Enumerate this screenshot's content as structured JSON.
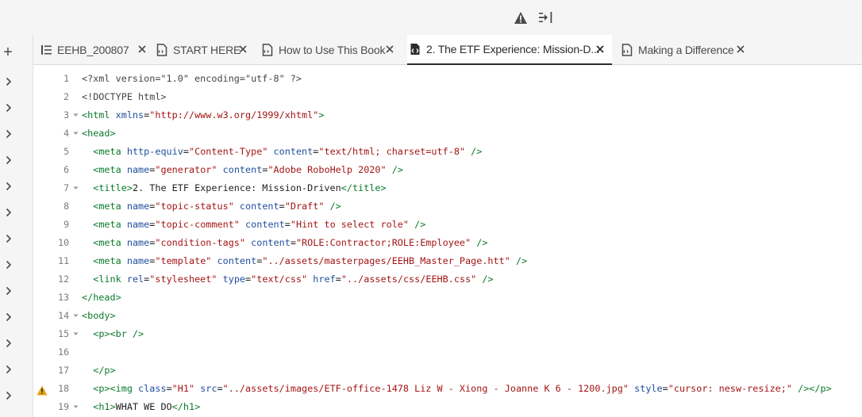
{
  "toolbar": {
    "warning_icon": "warning-triangle-icon",
    "indent_icon": "indent-right-icon"
  },
  "sidebar": {
    "add_icon": "plus-icon",
    "add_label": "+",
    "expander_icon": "chevron-right-icon",
    "expander_count": 13
  },
  "tabs": [
    {
      "label": "EEHB_200807",
      "icon": "toc-icon",
      "active": false
    },
    {
      "label": "START HERE",
      "icon": "topic-icon",
      "active": false
    },
    {
      "label": "How to Use This Book",
      "icon": "topic-icon",
      "active": false
    },
    {
      "label": "2. The ETF Experience: Mission-D...",
      "icon": "source-code-icon",
      "active": true
    },
    {
      "label": "Making a Difference",
      "icon": "topic-icon",
      "active": false
    }
  ],
  "editor": {
    "lines": [
      {
        "n": "1",
        "fold": false,
        "warn": false,
        "tokens": [
          [
            "t-pi",
            "<?xml version=\"1.0\" encoding=\"utf-8\" ?>"
          ]
        ]
      },
      {
        "n": "2",
        "fold": false,
        "warn": false,
        "tokens": [
          [
            "t-pi",
            "<!DOCTYPE html>"
          ]
        ]
      },
      {
        "n": "3",
        "fold": true,
        "warn": false,
        "tokens": [
          [
            "t-tag",
            "<html "
          ],
          [
            "t-attr",
            "xmlns"
          ],
          [
            "t-txt",
            "="
          ],
          [
            "t-str",
            "\"http://www.w3.org/1999/xhtml\""
          ],
          [
            "t-tag",
            ">"
          ]
        ]
      },
      {
        "n": "4",
        "fold": true,
        "warn": false,
        "tokens": [
          [
            "t-tag",
            "<head>"
          ]
        ]
      },
      {
        "n": "5",
        "fold": false,
        "warn": false,
        "tokens": [
          [
            "t-txt",
            "  "
          ],
          [
            "t-tag",
            "<meta "
          ],
          [
            "t-attr",
            "http-equiv"
          ],
          [
            "t-txt",
            "="
          ],
          [
            "t-str",
            "\"Content-Type\""
          ],
          [
            "t-txt",
            " "
          ],
          [
            "t-attr",
            "content"
          ],
          [
            "t-txt",
            "="
          ],
          [
            "t-str",
            "\"text/html; charset=utf-8\""
          ],
          [
            "t-tag",
            " />"
          ]
        ]
      },
      {
        "n": "6",
        "fold": false,
        "warn": false,
        "tokens": [
          [
            "t-txt",
            "  "
          ],
          [
            "t-tag",
            "<meta "
          ],
          [
            "t-attr",
            "name"
          ],
          [
            "t-txt",
            "="
          ],
          [
            "t-str",
            "\"generator\""
          ],
          [
            "t-txt",
            " "
          ],
          [
            "t-attr",
            "content"
          ],
          [
            "t-txt",
            "="
          ],
          [
            "t-str",
            "\"Adobe RoboHelp 2020\""
          ],
          [
            "t-tag",
            " />"
          ]
        ]
      },
      {
        "n": "7",
        "fold": true,
        "warn": false,
        "tokens": [
          [
            "t-txt",
            "  "
          ],
          [
            "t-tag",
            "<title>"
          ],
          [
            "t-txt",
            "2. The ETF Experience: Mission-Driven"
          ],
          [
            "t-tag",
            "</title>"
          ]
        ]
      },
      {
        "n": "8",
        "fold": false,
        "warn": false,
        "tokens": [
          [
            "t-txt",
            "  "
          ],
          [
            "t-tag",
            "<meta "
          ],
          [
            "t-attr",
            "name"
          ],
          [
            "t-txt",
            "="
          ],
          [
            "t-str",
            "\"topic-status\""
          ],
          [
            "t-txt",
            " "
          ],
          [
            "t-attr",
            "content"
          ],
          [
            "t-txt",
            "="
          ],
          [
            "t-str",
            "\"Draft\""
          ],
          [
            "t-tag",
            " />"
          ]
        ]
      },
      {
        "n": "9",
        "fold": false,
        "warn": false,
        "tokens": [
          [
            "t-txt",
            "  "
          ],
          [
            "t-tag",
            "<meta "
          ],
          [
            "t-attr",
            "name"
          ],
          [
            "t-txt",
            "="
          ],
          [
            "t-str",
            "\"topic-comment\""
          ],
          [
            "t-txt",
            " "
          ],
          [
            "t-attr",
            "content"
          ],
          [
            "t-txt",
            "="
          ],
          [
            "t-str",
            "\"Hint to select role\""
          ],
          [
            "t-tag",
            " />"
          ]
        ]
      },
      {
        "n": "10",
        "fold": false,
        "warn": false,
        "tokens": [
          [
            "t-txt",
            "  "
          ],
          [
            "t-tag",
            "<meta "
          ],
          [
            "t-attr",
            "name"
          ],
          [
            "t-txt",
            "="
          ],
          [
            "t-str",
            "\"condition-tags\""
          ],
          [
            "t-txt",
            " "
          ],
          [
            "t-attr",
            "content"
          ],
          [
            "t-txt",
            "="
          ],
          [
            "t-str",
            "\"ROLE:Contractor;ROLE:Employee\""
          ],
          [
            "t-tag",
            " />"
          ]
        ]
      },
      {
        "n": "11",
        "fold": false,
        "warn": false,
        "tokens": [
          [
            "t-txt",
            "  "
          ],
          [
            "t-tag",
            "<meta "
          ],
          [
            "t-attr",
            "name"
          ],
          [
            "t-txt",
            "="
          ],
          [
            "t-str",
            "\"template\""
          ],
          [
            "t-txt",
            " "
          ],
          [
            "t-attr",
            "content"
          ],
          [
            "t-txt",
            "="
          ],
          [
            "t-str",
            "\"../assets/masterpages/EEHB_Master_Page.htt\""
          ],
          [
            "t-tag",
            " />"
          ]
        ]
      },
      {
        "n": "12",
        "fold": false,
        "warn": false,
        "tokens": [
          [
            "t-txt",
            "  "
          ],
          [
            "t-tag",
            "<link "
          ],
          [
            "t-attr",
            "rel"
          ],
          [
            "t-txt",
            "="
          ],
          [
            "t-str",
            "\"stylesheet\""
          ],
          [
            "t-txt",
            " "
          ],
          [
            "t-attr",
            "type"
          ],
          [
            "t-txt",
            "="
          ],
          [
            "t-str",
            "\"text/css\""
          ],
          [
            "t-txt",
            " "
          ],
          [
            "t-attr",
            "href"
          ],
          [
            "t-txt",
            "="
          ],
          [
            "t-str",
            "\"../assets/css/EEHB.css\""
          ],
          [
            "t-tag",
            " />"
          ]
        ]
      },
      {
        "n": "13",
        "fold": false,
        "warn": false,
        "tokens": [
          [
            "t-tag",
            "</head>"
          ]
        ]
      },
      {
        "n": "14",
        "fold": true,
        "warn": false,
        "tokens": [
          [
            "t-tag",
            "<body>"
          ]
        ]
      },
      {
        "n": "15",
        "fold": true,
        "warn": false,
        "tokens": [
          [
            "t-txt",
            "  "
          ],
          [
            "t-tag",
            "<p><br />"
          ]
        ]
      },
      {
        "n": "16",
        "fold": false,
        "warn": false,
        "tokens": []
      },
      {
        "n": "17",
        "fold": false,
        "warn": false,
        "tokens": [
          [
            "t-txt",
            "  "
          ],
          [
            "t-tag",
            "</p>"
          ]
        ]
      },
      {
        "n": "18",
        "fold": false,
        "warn": true,
        "tokens": [
          [
            "t-txt",
            "  "
          ],
          [
            "t-tag",
            "<p><img "
          ],
          [
            "t-attr",
            "class"
          ],
          [
            "t-txt",
            "="
          ],
          [
            "t-str",
            "\"H1\""
          ],
          [
            "t-txt",
            " "
          ],
          [
            "t-attr",
            "src"
          ],
          [
            "t-txt",
            "="
          ],
          [
            "t-str",
            "\"../assets/images/ETF-office-1478 Liz W - Xiong - Joanne K 6 - 1200.jpg\""
          ],
          [
            "t-txt",
            " "
          ],
          [
            "t-attr",
            "style"
          ],
          [
            "t-txt",
            "="
          ],
          [
            "t-str",
            "\"cursor: nesw-resize;\""
          ],
          [
            "t-tag",
            " /></p>"
          ]
        ]
      },
      {
        "n": "19",
        "fold": true,
        "warn": false,
        "tokens": [
          [
            "t-txt",
            "  "
          ],
          [
            "t-tag",
            "<h1>"
          ],
          [
            "t-txt",
            "WHAT WE DO"
          ],
          [
            "t-tag",
            "</h1>"
          ]
        ]
      }
    ]
  }
}
